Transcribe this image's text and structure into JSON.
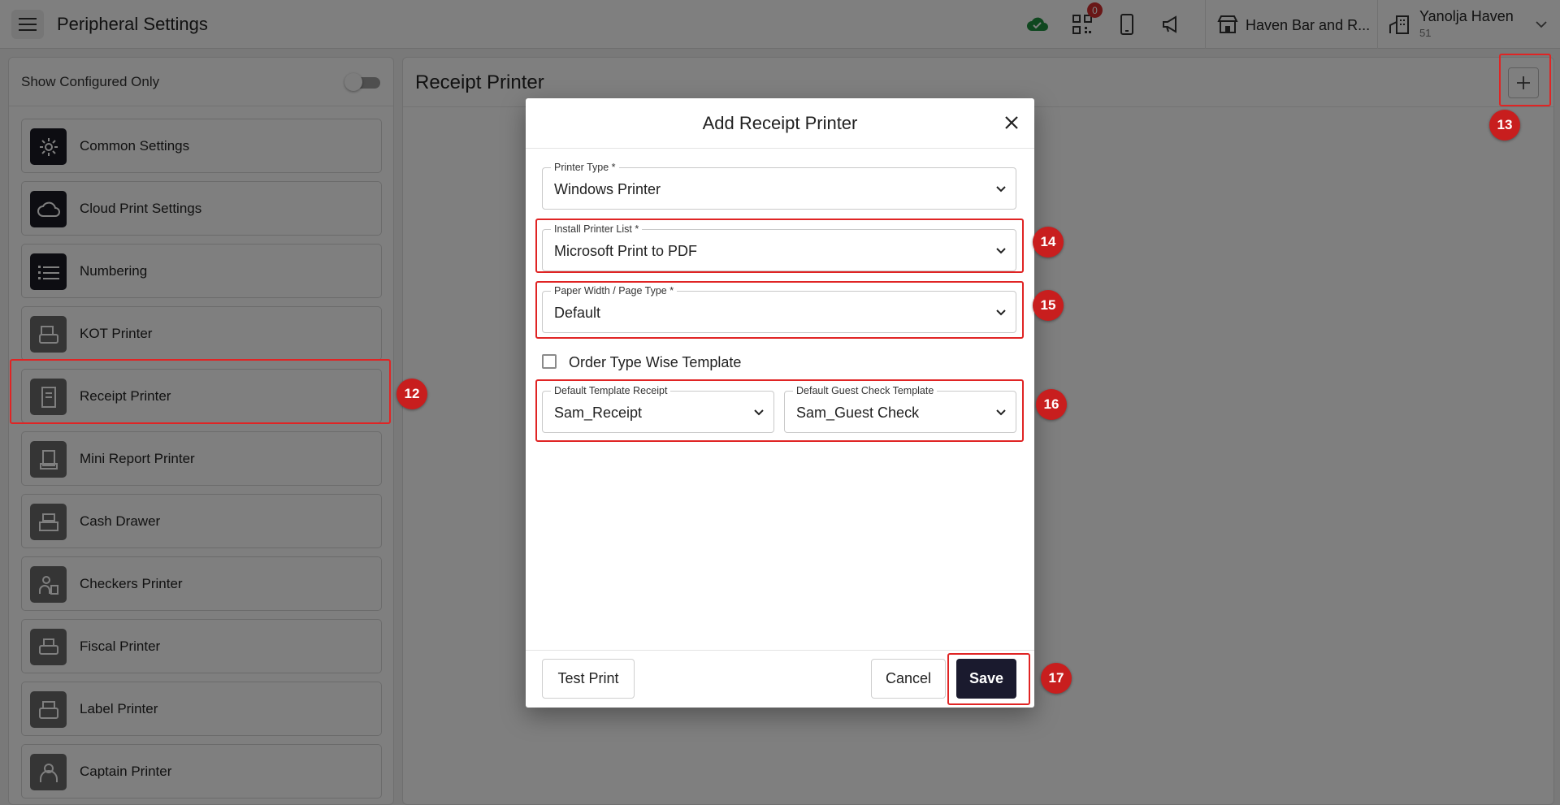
{
  "topbar": {
    "title": "Peripheral Settings",
    "notification_count": "0",
    "store_name": "Haven Bar and R...",
    "user_name": "Yanolja Haven",
    "user_sub": "51",
    "icons": [
      "menu-icon",
      "cloud-check-icon",
      "qr-scan-icon",
      "mobile-device-icon",
      "megaphone-icon",
      "store-icon",
      "building-icon",
      "chevron-down-icon"
    ]
  },
  "sidebar": {
    "filter_label": "Show Configured Only",
    "filter_on": false,
    "items": [
      {
        "label": "Common Settings",
        "icon": "gear-icon"
      },
      {
        "label": "Cloud Print Settings",
        "icon": "cloud-icon"
      },
      {
        "label": "Numbering",
        "icon": "list-icon"
      },
      {
        "label": "KOT Printer",
        "icon": "kot-printer-icon"
      },
      {
        "label": "Receipt Printer",
        "icon": "receipt-printer-icon"
      },
      {
        "label": "Mini Report Printer",
        "icon": "report-printer-icon"
      },
      {
        "label": "Cash Drawer",
        "icon": "cash-register-icon"
      },
      {
        "label": "Checkers Printer",
        "icon": "checker-icon"
      },
      {
        "label": "Fiscal Printer",
        "icon": "fiscal-printer-icon"
      },
      {
        "label": "Label Printer",
        "icon": "label-printer-icon"
      },
      {
        "label": "Captain Printer",
        "icon": "captain-icon"
      }
    ]
  },
  "main": {
    "title": "Receipt Printer",
    "add_icon": "plus-icon"
  },
  "dialog": {
    "title": "Add Receipt Printer",
    "printer_type": {
      "label": "Printer Type *",
      "value": "Windows Printer"
    },
    "install_printer": {
      "label": "Install Printer List *",
      "value": "Microsoft Print to PDF"
    },
    "paper_width": {
      "label": "Paper Width / Page Type *",
      "value": "Default"
    },
    "order_type_wise": {
      "label": "Order Type Wise Template",
      "checked": false
    },
    "default_template_receipt": {
      "label": "Default Template Receipt",
      "value": "Sam_Receipt"
    },
    "default_guest_check": {
      "label": "Default Guest Check Template",
      "value": "Sam_Guest Check"
    },
    "buttons": {
      "test_print": "Test Print",
      "cancel": "Cancel",
      "save": "Save"
    }
  },
  "annotations": [
    "12",
    "13",
    "14",
    "15",
    "16",
    "17"
  ],
  "colors": {
    "accent_dark": "#1a1a2e",
    "annotation_red": "#c81e1e",
    "badge_red": "#d32f2f",
    "cloud_green": "#1e8e3e"
  }
}
